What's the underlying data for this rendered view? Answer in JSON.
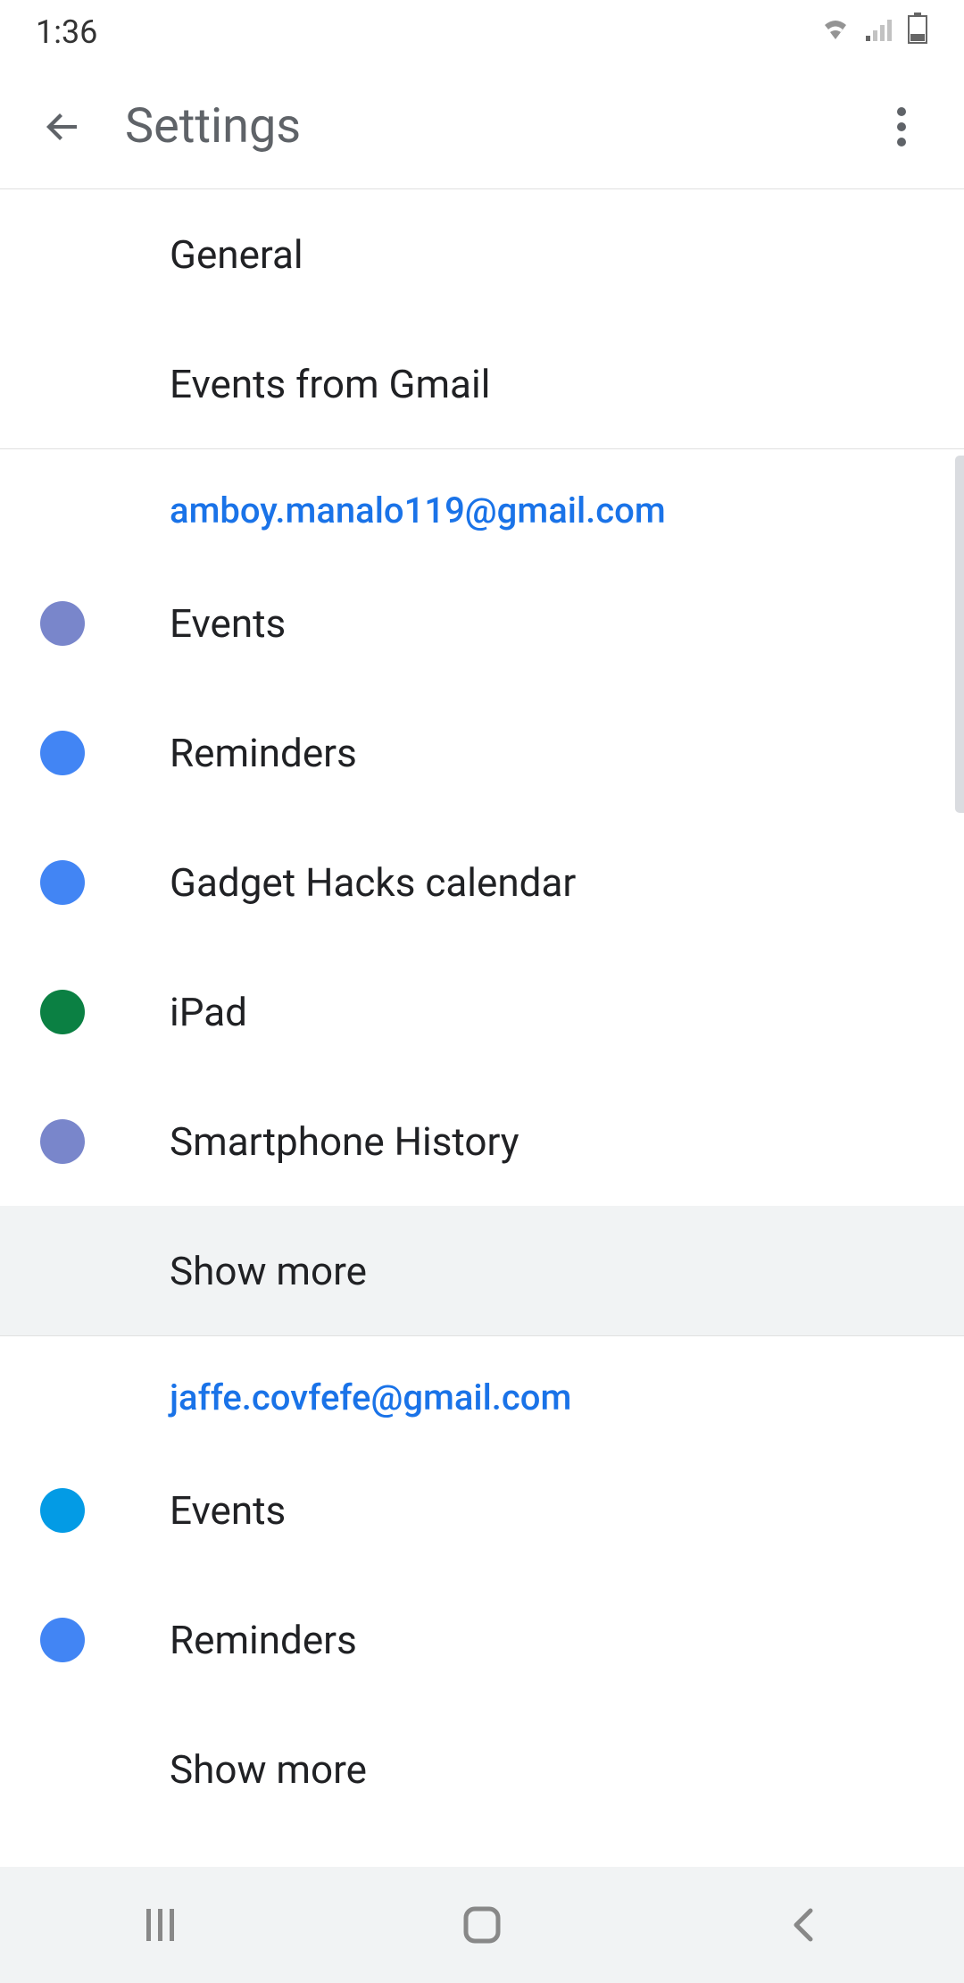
{
  "status_bar": {
    "time": "1:36"
  },
  "app_bar": {
    "title": "Settings"
  },
  "top_items": [
    {
      "label": "General"
    },
    {
      "label": "Events from Gmail"
    }
  ],
  "accounts": [
    {
      "email": "amboy.manalo119@gmail.com",
      "calendars": [
        {
          "label": "Events",
          "color": "#7986cb"
        },
        {
          "label": "Reminders",
          "color": "#4285f4"
        },
        {
          "label": "Gadget Hacks calendar",
          "color": "#4285f4"
        },
        {
          "label": "iPad",
          "color": "#0b8043"
        },
        {
          "label": "Smartphone History",
          "color": "#7986cb"
        }
      ],
      "show_more": "Show more",
      "show_more_highlighted": true
    },
    {
      "email": "jaffe.covfefe@gmail.com",
      "calendars": [
        {
          "label": "Events",
          "color": "#039be5"
        },
        {
          "label": "Reminders",
          "color": "#4285f4"
        }
      ],
      "show_more": "Show more",
      "show_more_highlighted": false
    }
  ]
}
